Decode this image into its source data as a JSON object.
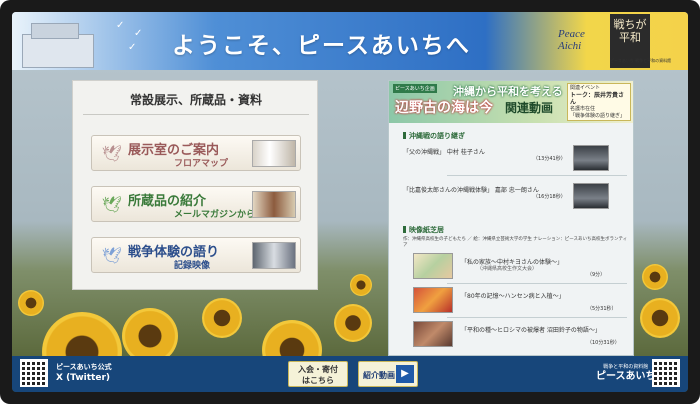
{
  "header": {
    "title": "ようこそ、ピースあいちへ",
    "logo_text": "Peace Aichi",
    "calligraphy": "戦ちが平和",
    "note": "ピースあいち 戦争と平和の資料館"
  },
  "left_panel": {
    "title": "常設展示、所蔵品・資料",
    "buttons": [
      {
        "main": "展示室のご案内",
        "sub": "フロアマップ"
      },
      {
        "main": "所蔵品の紹介",
        "sub": "メールマガジンから"
      },
      {
        "main": "戦争体験の語り",
        "sub": "記録映像"
      }
    ]
  },
  "right_panel": {
    "tag": "ピースあいち企画",
    "title": "沖縄から平和を考える",
    "big": "辺野古の海は今",
    "related": "関連動画",
    "talk": {
      "line1": "関連イベント",
      "line2": "トーク：辰井芳貴さん",
      "line3": "名護市在住",
      "line4": "「戦争体験の語り継ぎ」"
    },
    "section1": "沖縄戦の語り継ぎ",
    "videos1": [
      {
        "label": "「父の沖縄戦」 中村 桂子さん",
        "sub": "",
        "duration": "（13分41秒）"
      },
      {
        "label": "「比嘉俊太郎さんの沖縄戦体験」 嘉部 忠一朗さん",
        "sub": "",
        "duration": "（16分18秒）"
      }
    ],
    "section2": "映像紙芝居",
    "credits": "作：沖縄県高校生の子どもたち ／ 絵：沖縄県立芸術大学の学生 ナレーション：ピースあいち高校生ボランティア",
    "videos2": [
      {
        "label": "「私の家族～中村キヨさんの体験～」",
        "sub": "（沖縄県高校生作文大会）",
        "duration": "（9分）"
      },
      {
        "label": "「80年の記憶～ハンセン病と入植～」",
        "sub": "",
        "duration": "（5分31秒）"
      },
      {
        "label": "「平和の種～ヒロシマの被爆者 沼田鈴子の物語～」",
        "sub": "",
        "duration": "（10分31秒）"
      }
    ]
  },
  "bottom": {
    "twitter_line1": "ピースあいち公式",
    "twitter_line2": "X (Twitter)",
    "donate_line1": "入会・寄付",
    "donate_line2": "はこちら",
    "video_label": "紹介動画",
    "brand_small": "戦争と平和の資料館",
    "brand": "ピースあいち"
  },
  "colors": {
    "header_blue": "#2e6fc4",
    "bottom_bar": "#17467a",
    "section_green": "#2d6a3a"
  }
}
